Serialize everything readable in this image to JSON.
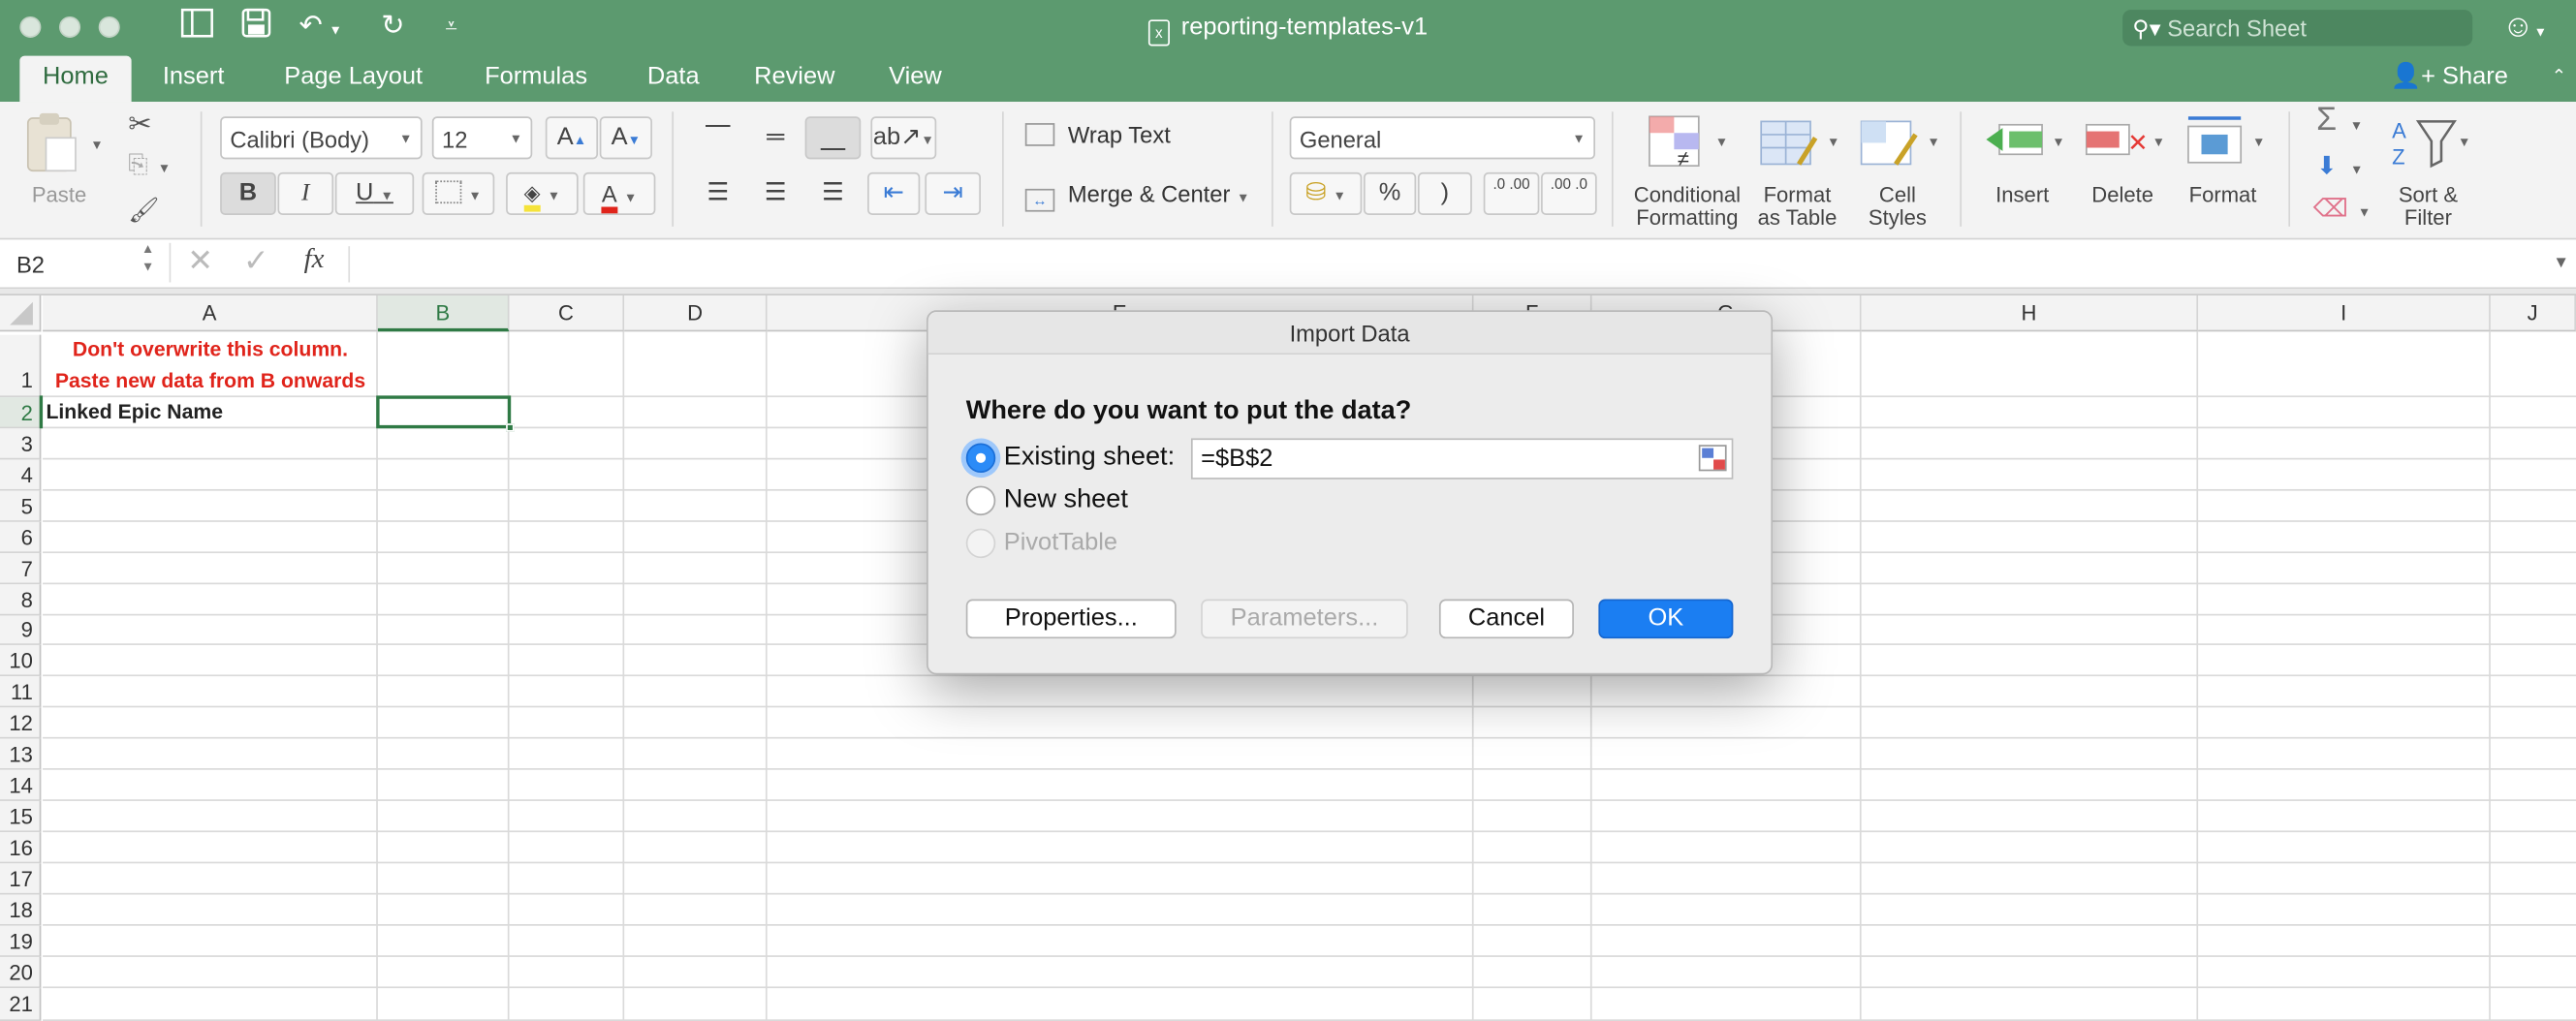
{
  "window": {
    "title": "reporting-templates-v1",
    "search_placeholder": "Search Sheet",
    "share_label": "Share"
  },
  "tabs": [
    "Home",
    "Insert",
    "Page Layout",
    "Formulas",
    "Data",
    "Review",
    "View"
  ],
  "ribbon": {
    "paste_label": "Paste",
    "font_name": "Calibri (Body)",
    "font_size": "12",
    "bold": "B",
    "italic": "I",
    "underline": "U",
    "wrap_text": "Wrap Text",
    "merge_center": "Merge & Center",
    "number_format": "General",
    "percent": "%",
    "comma": ")",
    "inc_decimal": ".0 .00",
    "dec_decimal": ".00 .0",
    "conditional_formatting": [
      "Conditional",
      "Formatting"
    ],
    "format_as_table": [
      "Format",
      "as Table"
    ],
    "cell_styles": [
      "Cell",
      "Styles"
    ],
    "insert": "Insert",
    "delete": "Delete",
    "format": "Format",
    "sort_filter": [
      "Sort &",
      "Filter"
    ]
  },
  "formula_bar": {
    "name_box": "B2",
    "fx": "fx",
    "content": ""
  },
  "sheet": {
    "columns": [
      "A",
      "B",
      "C",
      "D",
      "E",
      "F",
      "G",
      "H",
      "I",
      "J"
    ],
    "rows": [
      "1",
      "2",
      "3",
      "4",
      "5",
      "6",
      "7",
      "8",
      "9",
      "10",
      "11",
      "12",
      "13",
      "14",
      "15",
      "16",
      "17",
      "18",
      "19",
      "20",
      "21"
    ],
    "a1_line1": "Don't overwrite this column.",
    "a1_line2": "Paste new data from B onwards",
    "a2": "Linked Epic Name",
    "selected_cell": "B2"
  },
  "dialog": {
    "title": "Import Data",
    "question": "Where do you want to put the data?",
    "existing_sheet_label": "Existing sheet:",
    "existing_sheet_value": "=$B$2",
    "new_sheet_label": "New sheet",
    "pivot_label": "PivotTable",
    "properties_btn": "Properties...",
    "parameters_btn": "Parameters...",
    "cancel_btn": "Cancel",
    "ok_btn": "OK",
    "selected_option": "existing_sheet"
  },
  "colors": {
    "title_bar": "#5c9a6f",
    "accent_blue": "#1b7ef2",
    "error_red": "#e0241b",
    "selection_green": "#2f7a45"
  }
}
